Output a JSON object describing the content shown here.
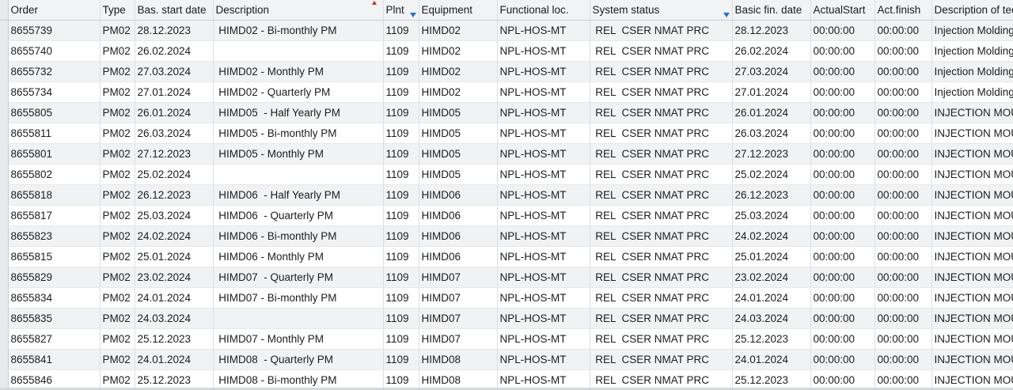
{
  "columns": [
    {
      "label": "Order",
      "sorted": false,
      "filtered": false
    },
    {
      "label": "Type",
      "sorted": false,
      "filtered": false
    },
    {
      "label": "Bas. start date",
      "sorted": false,
      "filtered": false
    },
    {
      "label": "Description",
      "sorted": true,
      "filtered": false
    },
    {
      "label": "Plnt",
      "sorted": false,
      "filtered": true
    },
    {
      "label": "Equipment",
      "sorted": false,
      "filtered": false
    },
    {
      "label": "Functional loc.",
      "sorted": false,
      "filtered": false
    },
    {
      "label": "System status",
      "sorted": false,
      "filtered": true
    },
    {
      "label": "Basic fin. date",
      "sorted": false,
      "filtered": false
    },
    {
      "label": "ActualStart",
      "sorted": false,
      "filtered": false
    },
    {
      "label": "Act.finish",
      "sorted": false,
      "filtered": false
    },
    {
      "label": "Description of technical object",
      "sorted": false,
      "filtered": false
    }
  ],
  "rows": [
    [
      "8655739",
      "PM02",
      "28.12.2023",
      " HIMD02 - Bi-monthly PM",
      "1109",
      "HIMD02",
      "NPL-HOS-MT",
      " REL  CSER NMAT PRC",
      "28.12.2023",
      "00:00:00",
      "00:00:00",
      "Injection Molding"
    ],
    [
      "8655740",
      "PM02",
      "26.02.2024",
      "",
      "1109",
      "HIMD02",
      "NPL-HOS-MT",
      " REL  CSER NMAT PRC",
      "26.02.2024",
      "00:00:00",
      "00:00:00",
      "Injection Molding"
    ],
    [
      "8655732",
      "PM02",
      "27.03.2024",
      " HIMD02 - Monthly PM",
      "1109",
      "HIMD02",
      "NPL-HOS-MT",
      " REL  CSER NMAT PRC",
      "27.03.2024",
      "00:00:00",
      "00:00:00",
      "Injection Molding"
    ],
    [
      "8655734",
      "PM02",
      "27.01.2024",
      " HIMD02 - Quarterly PM",
      "1109",
      "HIMD02",
      "NPL-HOS-MT",
      " REL  CSER NMAT PRC",
      "27.01.2024",
      "00:00:00",
      "00:00:00",
      "Injection Molding"
    ],
    [
      "8655805",
      "PM02",
      "26.01.2024",
      " HIMD05  - Half Yearly PM",
      "1109",
      "HIMD05",
      "NPL-HOS-MT",
      " REL  CSER NMAT PRC",
      "26.01.2024",
      "00:00:00",
      "00:00:00",
      "INJECTION MOULDING"
    ],
    [
      "8655811",
      "PM02",
      "26.03.2024",
      " HIMD05 - Bi-monthly PM",
      "1109",
      "HIMD05",
      "NPL-HOS-MT",
      " REL  CSER NMAT PRC",
      "26.03.2024",
      "00:00:00",
      "00:00:00",
      "INJECTION MOULDING"
    ],
    [
      "8655801",
      "PM02",
      "27.12.2023",
      " HIMD05 - Monthly PM",
      "1109",
      "HIMD05",
      "NPL-HOS-MT",
      " REL  CSER NMAT PRC",
      "27.12.2023",
      "00:00:00",
      "00:00:00",
      "INJECTION MOULDING"
    ],
    [
      "8655802",
      "PM02",
      "25.02.2024",
      "",
      "1109",
      "HIMD05",
      "NPL-HOS-MT",
      " REL  CSER NMAT PRC",
      "25.02.2024",
      "00:00:00",
      "00:00:00",
      "INJECTION MOULDING"
    ],
    [
      "8655818",
      "PM02",
      "26.12.2023",
      " HIMD06  - Half Yearly PM",
      "1109",
      "HIMD06",
      "NPL-HOS-MT",
      " REL  CSER NMAT PRC",
      "26.12.2023",
      "00:00:00",
      "00:00:00",
      "INJECTION MOULDING"
    ],
    [
      "8655817",
      "PM02",
      "25.03.2024",
      " HIMD06  - Quarterly PM",
      "1109",
      "HIMD06",
      "NPL-HOS-MT",
      " REL  CSER NMAT PRC",
      "25.03.2024",
      "00:00:00",
      "00:00:00",
      "INJECTION MOULDING"
    ],
    [
      "8655823",
      "PM02",
      "24.02.2024",
      " HIMD06 - Bi-monthly PM",
      "1109",
      "HIMD06",
      "NPL-HOS-MT",
      " REL  CSER NMAT PRC",
      "24.02.2024",
      "00:00:00",
      "00:00:00",
      "INJECTION MOULDING"
    ],
    [
      "8655815",
      "PM02",
      "25.01.2024",
      " HIMD06 - Monthly PM",
      "1109",
      "HIMD06",
      "NPL-HOS-MT",
      " REL  CSER NMAT PRC",
      "25.01.2024",
      "00:00:00",
      "00:00:00",
      "INJECTION MOULDING"
    ],
    [
      "8655829",
      "PM02",
      "23.02.2024",
      " HIMD07  - Quarterly PM",
      "1109",
      "HIMD07",
      "NPL-HOS-MT",
      " REL  CSER NMAT PRC",
      "23.02.2024",
      "00:00:00",
      "00:00:00",
      "INJECTION MOULDING"
    ],
    [
      "8655834",
      "PM02",
      "24.01.2024",
      " HIMD07 - Bi-monthly PM",
      "1109",
      "HIMD07",
      "NPL-HOS-MT",
      " REL  CSER NMAT PRC",
      "24.01.2024",
      "00:00:00",
      "00:00:00",
      "INJECTION MOULDING"
    ],
    [
      "8655835",
      "PM02",
      "24.03.2024",
      "",
      "1109",
      "HIMD07",
      "NPL-HOS-MT",
      " REL  CSER NMAT PRC",
      "24.03.2024",
      "00:00:00",
      "00:00:00",
      "INJECTION MOULDING"
    ],
    [
      "8655827",
      "PM02",
      "25.12.2023",
      " HIMD07 - Monthly PM",
      "1109",
      "HIMD07",
      "NPL-HOS-MT",
      " REL  CSER NMAT PRC",
      "25.12.2023",
      "00:00:00",
      "00:00:00",
      "INJECTION MOULDING"
    ],
    [
      "8655841",
      "PM02",
      "24.01.2024",
      " HIMD08  - Quarterly PM",
      "1109",
      "HIMD08",
      "NPL-HOS-MT",
      " REL  CSER NMAT PRC",
      "24.01.2024",
      "00:00:00",
      "00:00:00",
      "INJECTION MOULDING"
    ],
    [
      "8655846",
      "PM02",
      "25.12.2023",
      " HIMD08 - Bi-monthly PM",
      "1109",
      "HIMD08",
      "NPL-HOS-MT",
      " REL  CSER NMAT PRC",
      "25.12.2023",
      "00:00:00",
      "00:00:00",
      "INJECTION MOULDING"
    ]
  ],
  "colors": {
    "header_bg": "#f2f3f5",
    "row_alt_bg": "#f1f2f3",
    "sort_indicator": "#d0202a",
    "filter_indicator": "#2a6fc9"
  }
}
